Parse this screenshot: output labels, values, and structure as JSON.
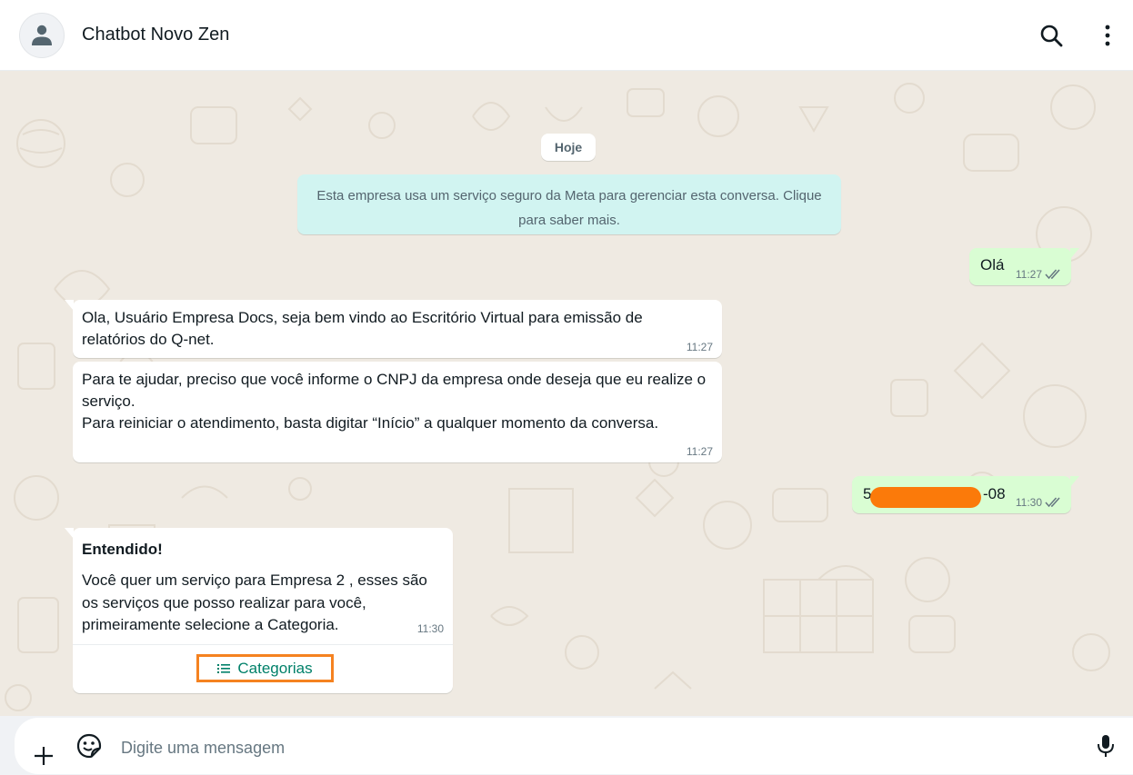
{
  "header": {
    "contact_name": "Chatbot Novo Zen",
    "avatar_icon": "person-icon",
    "search_icon": "search-icon",
    "menu_icon": "more-vertical-icon"
  },
  "chat": {
    "date_pill": "Hoje",
    "system_message": "Esta empresa usa um serviço seguro da Meta para gerenciar esta conversa. Clique para saber mais.",
    "messages": [
      {
        "direction": "out",
        "text": "Olá",
        "time": "11:27",
        "status": "read-double-check-icon"
      },
      {
        "direction": "in",
        "text": "Ola, Usuário Empresa Docs, seja bem vindo ao Escritório Virtual para emissão de relatórios do Q-net.",
        "time": "11:27"
      },
      {
        "direction": "in",
        "line1": "Para te ajudar, preciso que você informe o CNPJ da empresa onde deseja que eu realize o serviço.",
        "line2": "Para reiniciar o atendimento, basta digitar “Início” a qualquer momento da conversa.",
        "time": "11:27"
      },
      {
        "direction": "out",
        "text_prefix": "5",
        "text_suffix": "-08",
        "redacted": true,
        "time": "11:30",
        "status": "read-double-check-icon"
      },
      {
        "direction": "in",
        "header": "Entendido!",
        "body": "Você quer um serviço para Empresa 2 , esses são os serviços que posso realizar para você, primeiramente selecione a Categoria.",
        "time": "11:30",
        "button_label": "Categorias",
        "button_icon": "list-icon"
      }
    ]
  },
  "footer": {
    "attach_icon": "plus-icon",
    "sticker_icon": "sticker-icon",
    "input_placeholder": "Digite uma mensagem",
    "input_value": "",
    "mic_icon": "microphone-icon"
  },
  "colors": {
    "chat_background": "#efeae2",
    "outgoing_bubble": "#d9fdd3",
    "incoming_bubble": "#ffffff",
    "system_message_bg": "#d1f4f1",
    "accent_green": "#008069",
    "highlight_orange": "#f58220",
    "redaction": "#fb7a0a",
    "read_ticks": "#667781"
  }
}
